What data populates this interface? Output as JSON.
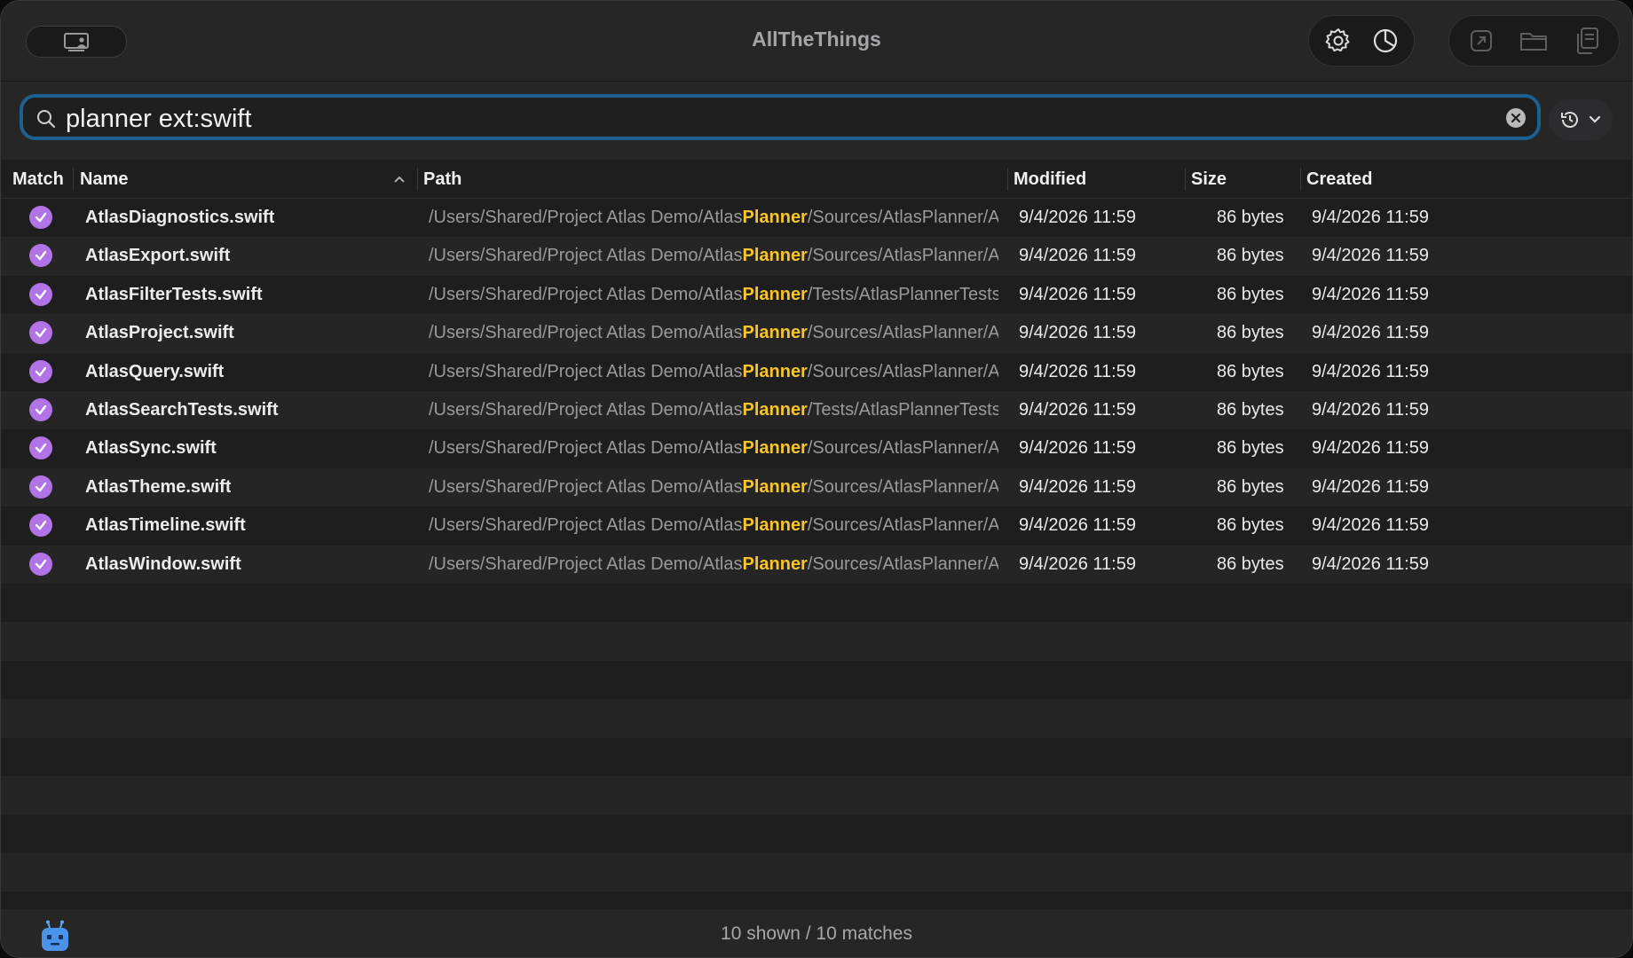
{
  "window": {
    "title": "AllTheThings"
  },
  "search": {
    "value": "planner ext:swift",
    "placeholder": ""
  },
  "columns": {
    "match": "Match",
    "name": "Name",
    "path": "Path",
    "modified": "Modified",
    "size": "Size",
    "created": "Created"
  },
  "rows": [
    {
      "name": "AtlasDiagnostics.swift",
      "path_pre": "/Users/Shared/Project Atlas Demo/Atlas",
      "path_hl": "Planner",
      "path_post": "/Sources/AtlasPlanner/AtlasDiagnostics.swift",
      "modified": "9/4/2026 11:59",
      "size": "86 bytes",
      "created": "9/4/2026 11:59"
    },
    {
      "name": "AtlasExport.swift",
      "path_pre": "/Users/Shared/Project Atlas Demo/Atlas",
      "path_hl": "Planner",
      "path_post": "/Sources/AtlasPlanner/AtlasExport.swift",
      "modified": "9/4/2026 11:59",
      "size": "86 bytes",
      "created": "9/4/2026 11:59"
    },
    {
      "name": "AtlasFilterTests.swift",
      "path_pre": "/Users/Shared/Project Atlas Demo/Atlas",
      "path_hl": "Planner",
      "path_post": "/Tests/AtlasPlannerTests/AtlasFilterTests.swift",
      "modified": "9/4/2026 11:59",
      "size": "86 bytes",
      "created": "9/4/2026 11:59"
    },
    {
      "name": "AtlasProject.swift",
      "path_pre": "/Users/Shared/Project Atlas Demo/Atlas",
      "path_hl": "Planner",
      "path_post": "/Sources/AtlasPlanner/AtlasProject.swift",
      "modified": "9/4/2026 11:59",
      "size": "86 bytes",
      "created": "9/4/2026 11:59"
    },
    {
      "name": "AtlasQuery.swift",
      "path_pre": "/Users/Shared/Project Atlas Demo/Atlas",
      "path_hl": "Planner",
      "path_post": "/Sources/AtlasPlanner/AtlasQuery.swift",
      "modified": "9/4/2026 11:59",
      "size": "86 bytes",
      "created": "9/4/2026 11:59"
    },
    {
      "name": "AtlasSearchTests.swift",
      "path_pre": "/Users/Shared/Project Atlas Demo/Atlas",
      "path_hl": "Planner",
      "path_post": "/Tests/AtlasPlannerTests/AtlasSearchTests.swift",
      "modified": "9/4/2026 11:59",
      "size": "86 bytes",
      "created": "9/4/2026 11:59"
    },
    {
      "name": "AtlasSync.swift",
      "path_pre": "/Users/Shared/Project Atlas Demo/Atlas",
      "path_hl": "Planner",
      "path_post": "/Sources/AtlasPlanner/AtlasSync.swift",
      "modified": "9/4/2026 11:59",
      "size": "86 bytes",
      "created": "9/4/2026 11:59"
    },
    {
      "name": "AtlasTheme.swift",
      "path_pre": "/Users/Shared/Project Atlas Demo/Atlas",
      "path_hl": "Planner",
      "path_post": "/Sources/AtlasPlanner/AtlasTheme.swift",
      "modified": "9/4/2026 11:59",
      "size": "86 bytes",
      "created": "9/4/2026 11:59"
    },
    {
      "name": "AtlasTimeline.swift",
      "path_pre": "/Users/Shared/Project Atlas Demo/Atlas",
      "path_hl": "Planner",
      "path_post": "/Sources/AtlasPlanner/AtlasTimeline.swift",
      "modified": "9/4/2026 11:59",
      "size": "86 bytes",
      "created": "9/4/2026 11:59"
    },
    {
      "name": "AtlasWindow.swift",
      "path_pre": "/Users/Shared/Project Atlas Demo/Atlas",
      "path_hl": "Planner",
      "path_post": "/Sources/AtlasPlanner/AtlasWindow.swift",
      "modified": "9/4/2026 11:59",
      "size": "86 bytes",
      "created": "9/4/2026 11:59"
    }
  ],
  "status": {
    "text": "10 shown / 10 matches"
  },
  "toolbar": {
    "icons": [
      "sidebar-toggle-icon",
      "gear-icon",
      "pie-chart-icon",
      "open-external-icon",
      "folder-icon",
      "copy-icon"
    ]
  },
  "colors": {
    "accent": "#1d5f8f",
    "match": "#b273e6",
    "highlight": "#f7c52a"
  }
}
